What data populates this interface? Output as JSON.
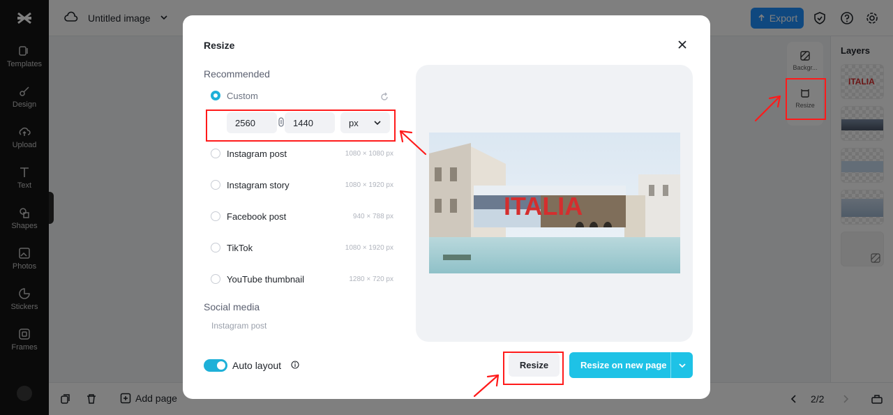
{
  "sidebar": {
    "items": [
      {
        "label": "Templates",
        "icon": "templates-icon"
      },
      {
        "label": "Design",
        "icon": "design-icon"
      },
      {
        "label": "Upload",
        "icon": "upload-icon"
      },
      {
        "label": "Text",
        "icon": "text-icon"
      },
      {
        "label": "Shapes",
        "icon": "shapes-icon"
      },
      {
        "label": "Photos",
        "icon": "photos-icon"
      },
      {
        "label": "Stickers",
        "icon": "stickers-icon"
      },
      {
        "label": "Frames",
        "icon": "frames-icon"
      }
    ]
  },
  "header": {
    "title": "Untitled image",
    "export_label": "Export"
  },
  "bottombar": {
    "add_page_label": "Add page",
    "page_indicator": "2/2"
  },
  "tools": {
    "background_label": "Backgr...",
    "resize_label": "Resize"
  },
  "layers": {
    "title": "Layers",
    "thumb_text": "ITALIA"
  },
  "modal": {
    "title": "Resize",
    "recommended_label": "Recommended",
    "social_media_label": "Social media",
    "custom": {
      "label": "Custom",
      "width": "2560",
      "height": "1440",
      "unit": "px"
    },
    "presets": [
      {
        "label": "Instagram post",
        "size": "1080 × 1080 px"
      },
      {
        "label": "Instagram story",
        "size": "1080 × 1920 px"
      },
      {
        "label": "Facebook post",
        "size": "940 × 788 px"
      },
      {
        "label": "TikTok",
        "size": "1080 × 1920 px"
      },
      {
        "label": "YouTube thumbnail",
        "size": "1280 × 720 px"
      }
    ],
    "social_media_items": [
      {
        "label": "Instagram post"
      }
    ],
    "preview_text": "ITALIA",
    "auto_layout_label": "Auto layout",
    "resize_button": "Resize",
    "resize_new_page_button": "Resize on new page"
  },
  "colors": {
    "accent": "#1ec2e6",
    "export_blue": "#1e90ff",
    "annotation_red": "#ff1a1a"
  }
}
